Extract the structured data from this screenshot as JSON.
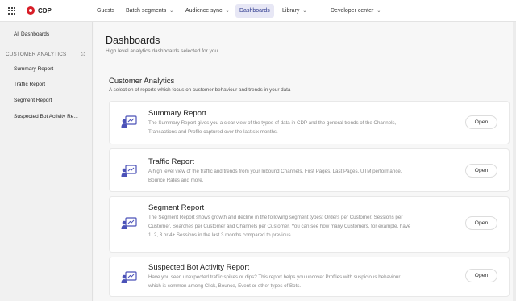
{
  "app": {
    "logo_text": "CDP"
  },
  "topnav": {
    "guests": "Guests",
    "batch_segments": "Batch segments",
    "audience_sync": "Audience sync",
    "dashboards": "Dashboards",
    "library": "Library",
    "developer_center": "Developer center"
  },
  "sidebar": {
    "all_dashboards": "All Dashboards",
    "section_label": "CUSTOMER ANALYTICS",
    "items": [
      "Summary Report",
      "Traffic Report",
      "Segment Report",
      "Suspected Bot Activity Re..."
    ]
  },
  "main": {
    "title": "Dashboards",
    "subtitle": "High level analytics dashboards selected for you.",
    "section_title": "Customer Analytics",
    "section_subtitle": "A selection of reports which focus on customer behaviour and trends in your data",
    "open_label": "Open",
    "cards": [
      {
        "title": "Summary Report",
        "desc_lines": [
          "The Summary Report gives you a clear view of the types of data in CDP and the general trends of the Channels,",
          "Transactions and Profile captured over the last six months."
        ]
      },
      {
        "title": "Traffic Report",
        "desc_lines": [
          "A high level view of the traffic and trends from your Inbound Channels, First Pages, Last Pages, UTM performance,",
          "Bounce Rates and more."
        ]
      },
      {
        "title": "Segment Report",
        "desc_lines": [
          "The Segment Report shows growth and decline in the following segment types; Orders per Customer, Sessions per",
          "Customer, Searches per Customer and Channels per Customer. You can see how many Customers, for example, have",
          "1, 2, 3 or 4+ Sessions in the last 3 months compared to previous."
        ]
      },
      {
        "title": "Suspected Bot Activity Report",
        "desc_lines": [
          "Have you seen unexpected traffic spikes or dips? This report helps you uncover Profiles with suspicious behaviour",
          "which is common among Click, Bounce, Event or other types of Bots."
        ]
      }
    ]
  },
  "colors": {
    "brand": "#d81e28",
    "accent": "#4b52b8",
    "active_nav_bg": "#e7e7f5"
  }
}
